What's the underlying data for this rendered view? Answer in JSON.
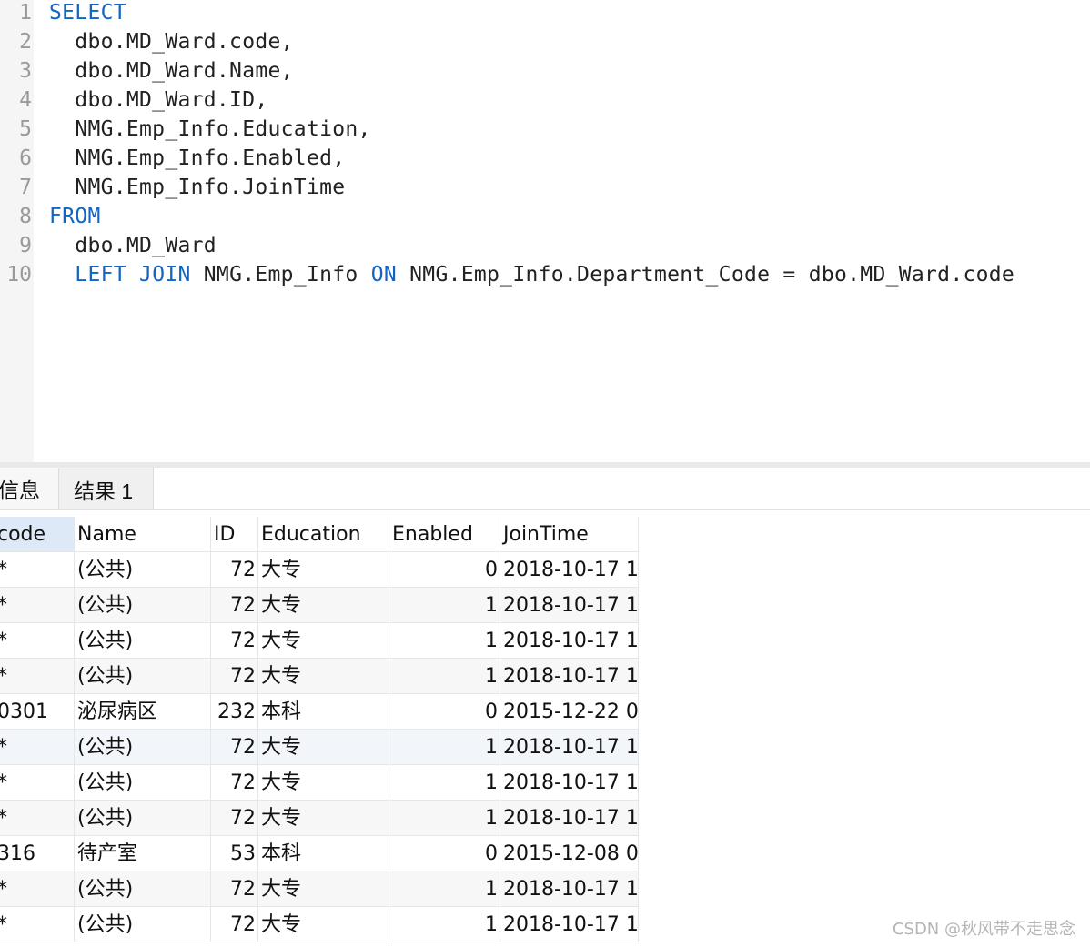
{
  "editor": {
    "lines": [
      {
        "n": "1",
        "segments": [
          {
            "t": "SELECT",
            "kw": true
          }
        ]
      },
      {
        "n": "2",
        "segments": [
          {
            "t": "  dbo.MD_Ward.code,"
          }
        ]
      },
      {
        "n": "3",
        "segments": [
          {
            "t": "  dbo.MD_Ward.Name,"
          }
        ]
      },
      {
        "n": "4",
        "segments": [
          {
            "t": "  dbo.MD_Ward.ID,"
          }
        ]
      },
      {
        "n": "5",
        "segments": [
          {
            "t": "  NMG.Emp_Info.Education,"
          }
        ]
      },
      {
        "n": "6",
        "segments": [
          {
            "t": "  NMG.Emp_Info.Enabled,"
          }
        ]
      },
      {
        "n": "7",
        "segments": [
          {
            "t": "  NMG.Emp_Info.JoinTime"
          }
        ]
      },
      {
        "n": "8",
        "segments": [
          {
            "t": "FROM",
            "kw": true
          }
        ]
      },
      {
        "n": "9",
        "segments": [
          {
            "t": "  dbo.MD_Ward"
          }
        ]
      },
      {
        "n": "10",
        "segments": [
          {
            "t": "  "
          },
          {
            "t": "LEFT",
            "kw": true
          },
          {
            "t": " "
          },
          {
            "t": "JOIN",
            "kw": true
          },
          {
            "t": " NMG.Emp_Info "
          },
          {
            "t": "ON",
            "kw": true
          },
          {
            "t": " NMG.Emp_Info.Department_Code = dbo.MD_Ward.code"
          }
        ]
      }
    ],
    "keyword_color": "#1565c0"
  },
  "tabs": {
    "info": "信息",
    "result": "结果 1"
  },
  "grid": {
    "columns": [
      "code",
      "Name",
      "ID",
      "Education",
      "Enabled",
      "JoinTime"
    ],
    "rows": [
      [
        "*",
        "(公共)",
        "72",
        "大专",
        "0",
        "2018-10-17 1"
      ],
      [
        "*",
        "(公共)",
        "72",
        "大专",
        "1",
        "2018-10-17 1"
      ],
      [
        "*",
        "(公共)",
        "72",
        "大专",
        "1",
        "2018-10-17 1"
      ],
      [
        "*",
        "(公共)",
        "72",
        "大专",
        "1",
        "2018-10-17 1"
      ],
      [
        "0301",
        "泌尿病区",
        "232",
        "本科",
        "0",
        "2015-12-22 0"
      ],
      [
        "*",
        "(公共)",
        "72",
        "大专",
        "1",
        "2018-10-17 1"
      ],
      [
        "*",
        "(公共)",
        "72",
        "大专",
        "1",
        "2018-10-17 1"
      ],
      [
        "*",
        "(公共)",
        "72",
        "大专",
        "1",
        "2018-10-17 1"
      ],
      [
        "316",
        "待产室",
        "53",
        "本科",
        "0",
        "2015-12-08 0"
      ],
      [
        "*",
        "(公共)",
        "72",
        "大专",
        "1",
        "2018-10-17 1"
      ],
      [
        "*",
        "(公共)",
        "72",
        "大专",
        "1",
        "2018-10-17 1"
      ]
    ]
  },
  "watermark": "CSDN @秋风带不走思念"
}
